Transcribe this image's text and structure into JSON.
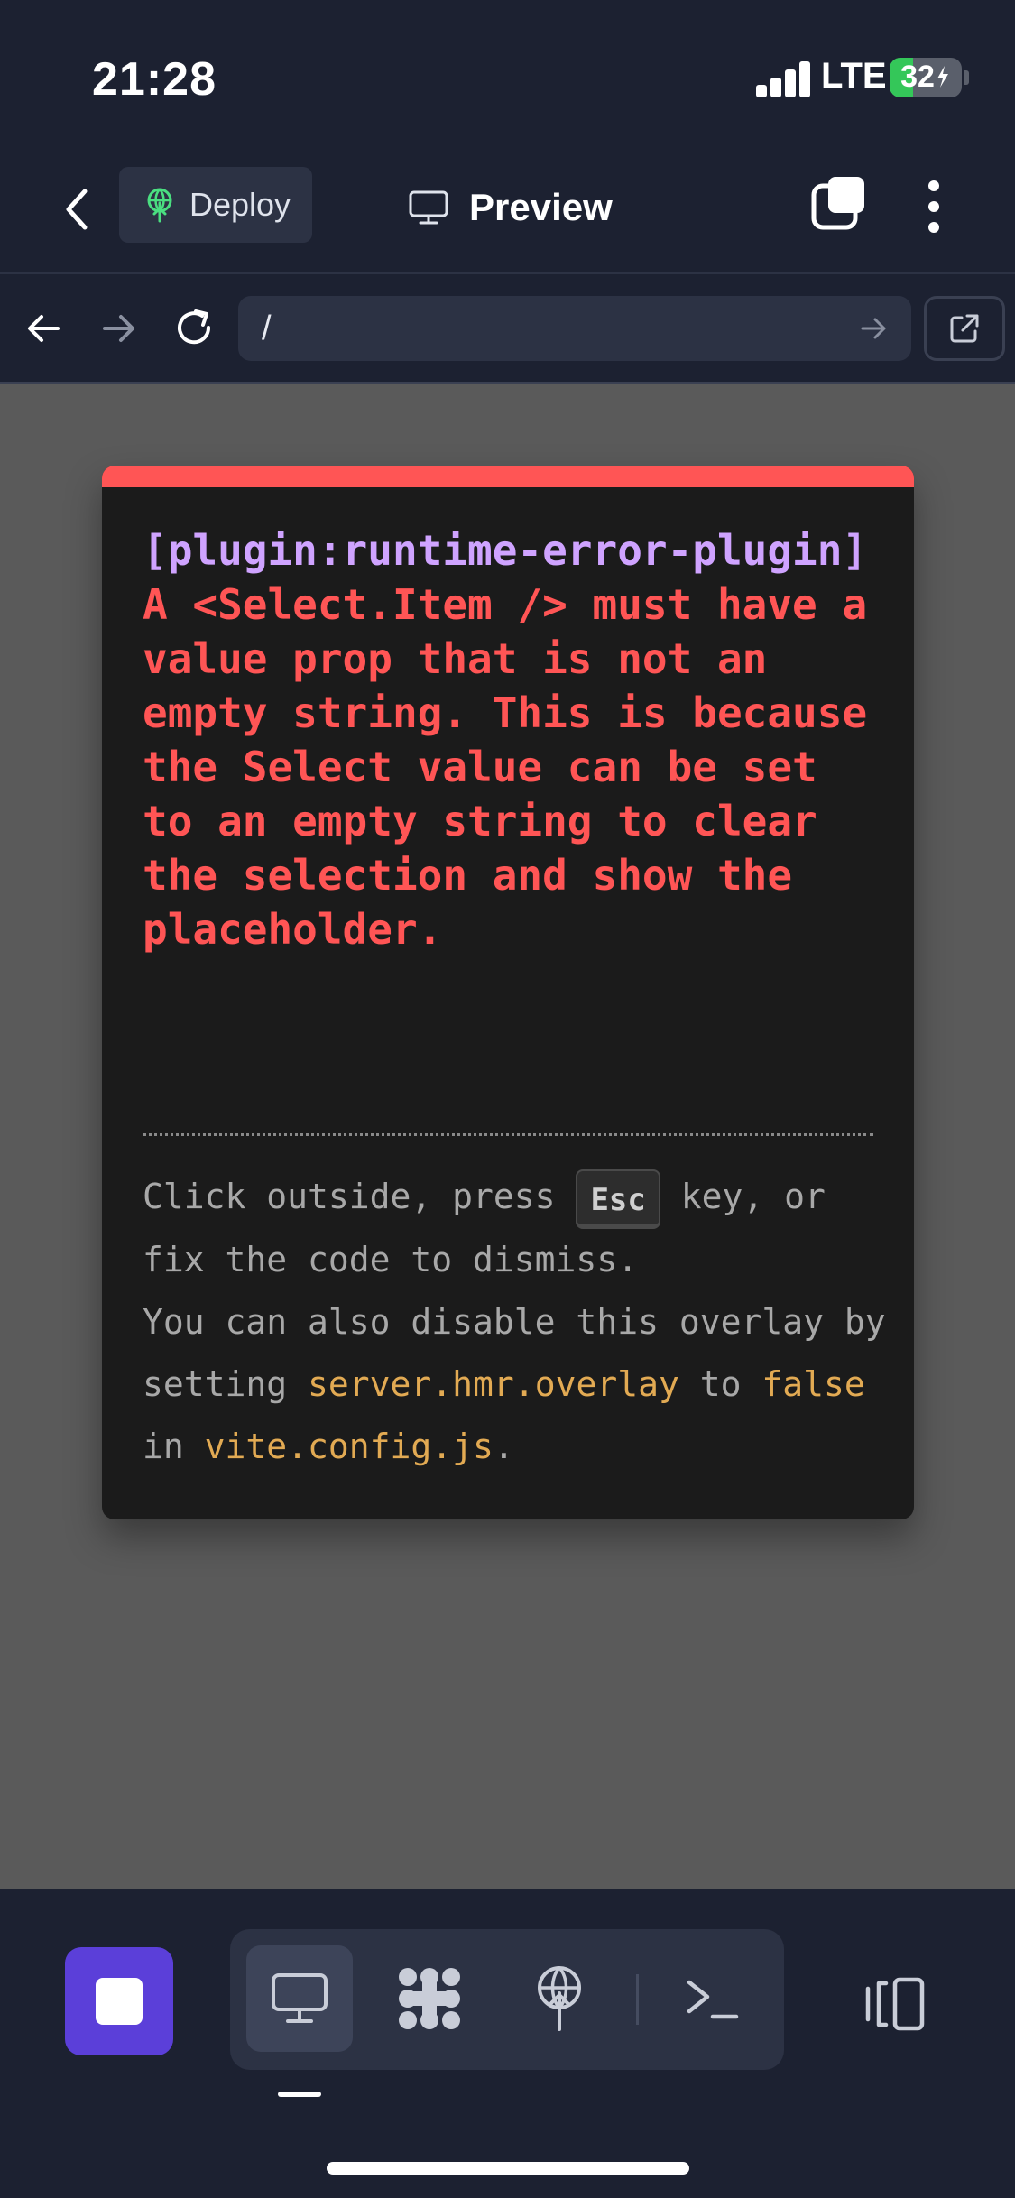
{
  "status_bar": {
    "time": "21:28",
    "network": "LTE",
    "battery": "32",
    "battery_level_percent": 32,
    "signal_bars": 4
  },
  "toolbar": {
    "back_icon": "chevron-left-icon",
    "deploy_label": "Deploy",
    "deploy_icon": "deploy-globe-icon",
    "title": "Preview",
    "title_icon": "monitor-icon",
    "tabs_icon": "tabs-icon",
    "more_icon": "more-vertical-icon"
  },
  "url_bar": {
    "url": "/",
    "back_icon": "arrow-left-icon",
    "forward_icon": "arrow-right-icon",
    "reload_icon": "reload-icon",
    "go_icon": "arrow-right-icon",
    "external_icon": "external-link-icon"
  },
  "error_overlay": {
    "plugin": "[plugin:runtime-error-plugin]",
    "message": "A <Select.Item /> must have a value prop that is not an empty string. This is because the Select value can be set to an empty string to clear the selection and show the placeholder.",
    "tip": {
      "part1": "Click outside, press ",
      "key": "Esc",
      "part2": " key, or fix the code to dismiss.",
      "part3": "You can also disable this overlay by setting ",
      "code1": "server.hmr.overlay",
      "part4": " to ",
      "code2": "false",
      "part5": " in ",
      "code3": "vite.config.js",
      "part6": "."
    },
    "accent_color": "#ff5555",
    "plugin_color": "#cfa3ff",
    "code_color": "#e2aa53"
  },
  "bottom_bar": {
    "stop_icon": "stop-icon",
    "tools": [
      {
        "icon": "monitor-icon",
        "active": true
      },
      {
        "icon": "agents-icon",
        "active": false
      },
      {
        "icon": "deploy-icon",
        "active": false
      },
      {
        "icon": "terminal-icon",
        "active": false
      }
    ],
    "panel_icon": "panel-toggle-icon",
    "stop_color": "#5b3fd9"
  }
}
